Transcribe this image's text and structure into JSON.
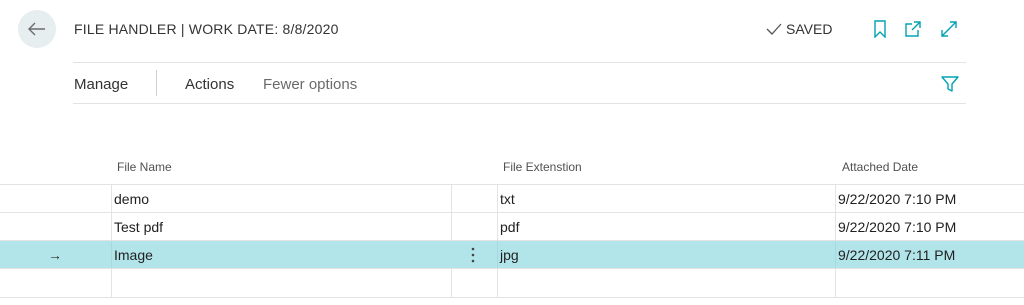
{
  "header": {
    "title": "FILE HANDLER | WORK DATE: 8/8/2020",
    "saved_label": "SAVED",
    "back_icon": "back-arrow-icon",
    "bookmark_icon": "bookmark-icon",
    "open_new_window_icon": "open-new-window-icon",
    "expand_icon": "expand-icon"
  },
  "action_bar": {
    "items": [
      {
        "label": "Manage"
      },
      {
        "label": "Actions"
      },
      {
        "label": "Fewer options"
      }
    ],
    "filter_icon": "filter-icon"
  },
  "grid": {
    "columns": [
      "File Name",
      "File Extenstion",
      "Attached Date"
    ],
    "rows": [
      {
        "file_name": "demo",
        "extension": "txt",
        "attached_date": "9/22/2020 7:10 PM"
      },
      {
        "file_name": "Test pdf",
        "extension": "pdf",
        "attached_date": "9/22/2020 7:10 PM"
      },
      {
        "file_name": "Image",
        "extension": "jpg",
        "attached_date": "9/22/2020 7:11 PM",
        "selected": true,
        "indicator": "→"
      },
      {
        "file_name": "",
        "extension": "",
        "attached_date": ""
      }
    ]
  },
  "colors": {
    "accent": "#00a3b2",
    "selected_row": "#b2e5ea",
    "back_button_bg": "#e6eef0"
  }
}
